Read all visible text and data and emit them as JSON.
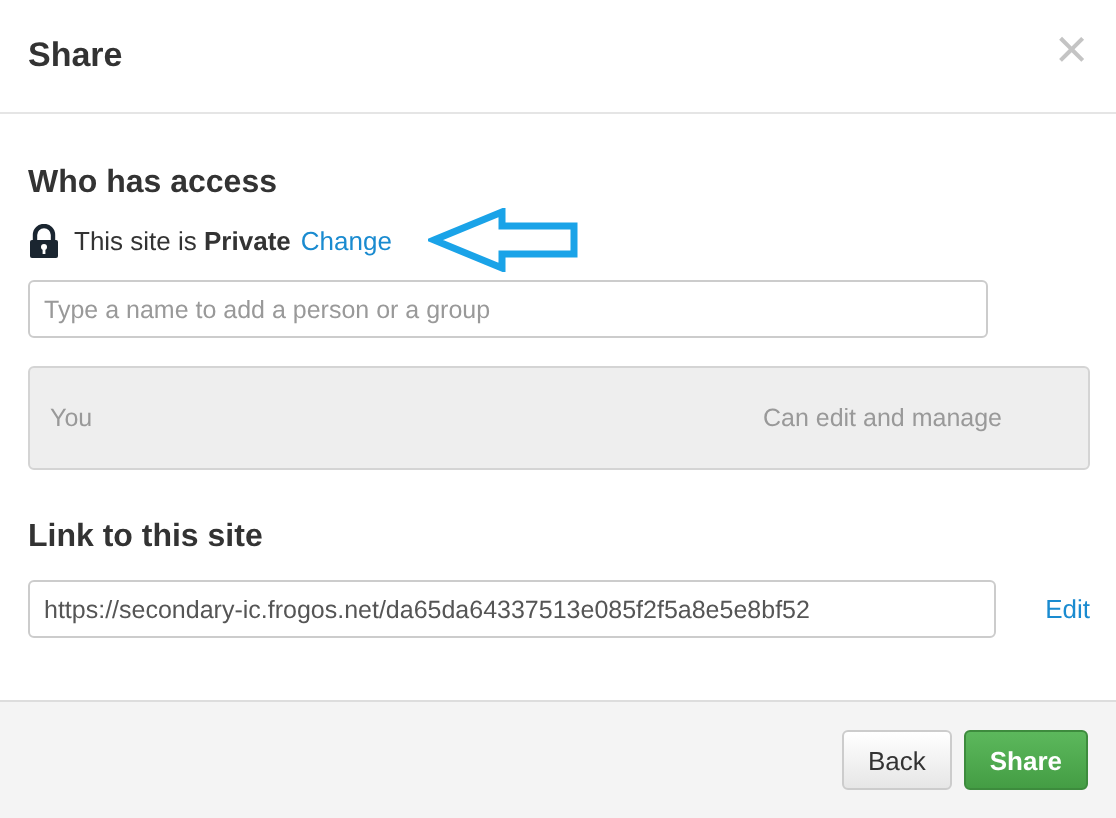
{
  "dialog": {
    "title": "Share",
    "close": "×"
  },
  "access": {
    "heading": "Who has access",
    "status": "This site is **Private**",
    "change_link": "Change",
    "add_field": {
      "placeholder": "Type a name to add a person or a group"
    },
    "members": [
      {
        "name": "You",
        "permission": "Can edit and manage"
      }
    ]
  },
  "link": {
    "heading": "Link to this site",
    "url": "https://secondary-ic.frogos.net/da65da64337513e085f2f5a8e5e8bf52",
    "edit_link": "Edit"
  },
  "buttons": [
    {
      "label": "Back",
      "kind": "secondary"
    },
    {
      "label": "Share",
      "kind": "primary"
    }
  ]
}
